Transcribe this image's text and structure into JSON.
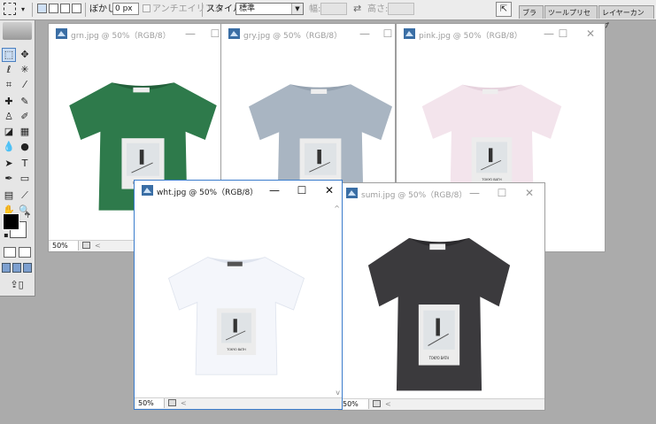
{
  "options_bar": {
    "feather_label": "ぼかし:",
    "feather_value": "0 px",
    "antialias_label": "アンチエイリアス",
    "style_label": "スタイル:",
    "style_value": "標準",
    "width_label": "幅:",
    "height_label": "高さ:",
    "palette_tabs": [
      "ブラシ",
      "ツールプリセット",
      "レイヤーカンプ"
    ]
  },
  "documents": [
    {
      "title": "grn.jpg @ 50%（RGB/8）",
      "zoom": "",
      "shirt_color": "#2e7a4b",
      "shirt_shade": "#22603a"
    },
    {
      "title": "gry.jpg @ 50%（RGB/8）",
      "zoom": "",
      "shirt_color": "#a9b5c2",
      "shirt_shade": "#95a2b0"
    },
    {
      "title": "pink.jpg @ 50%（RGB/8）",
      "zoom": "",
      "shirt_color": "#f3e4ec",
      "shirt_shade": "#e6d2dd"
    },
    {
      "title": "wht.jpg @ 50%（RGB/8）",
      "zoom": "50%",
      "shirt_color": "#f4f6fb",
      "shirt_shade": "#dfe4ee"
    },
    {
      "title": "sumi.jpg @ 50%（RGB/8）",
      "zoom": "",
      "shirt_color": "#3b3a3d",
      "shirt_shade": "#2b2a2d"
    }
  ],
  "zoom_behind": [
    "50%",
    "50%"
  ],
  "window_controls": {
    "minimize": "—",
    "maximize": "☐",
    "close": "✕"
  },
  "icons": {
    "marquee": "marquee-tool-icon",
    "move": "move-tool-icon",
    "lasso": "lasso-tool-icon",
    "magic_wand": "magic-wand-icon",
    "crop": "crop-tool-icon",
    "slice": "slice-tool-icon",
    "healing": "healing-brush-icon",
    "brush": "brush-tool-icon",
    "stamp": "clone-stamp-icon",
    "history_brush": "history-brush-icon",
    "eraser": "eraser-icon",
    "gradient": "gradient-icon",
    "blur": "blur-icon",
    "dodge": "dodge-icon",
    "path_select": "path-select-icon",
    "type": "type-tool-icon",
    "pen": "pen-tool-icon",
    "shape": "rectangle-shape-icon",
    "notes": "notes-icon",
    "eyedropper": "eyedropper-icon",
    "hand": "hand-tool-icon",
    "zoom": "zoom-tool-icon"
  },
  "colors": {
    "active_border": "#3a7ccc",
    "app_background": "#ababab"
  },
  "print_text": "TOKYO BATH"
}
